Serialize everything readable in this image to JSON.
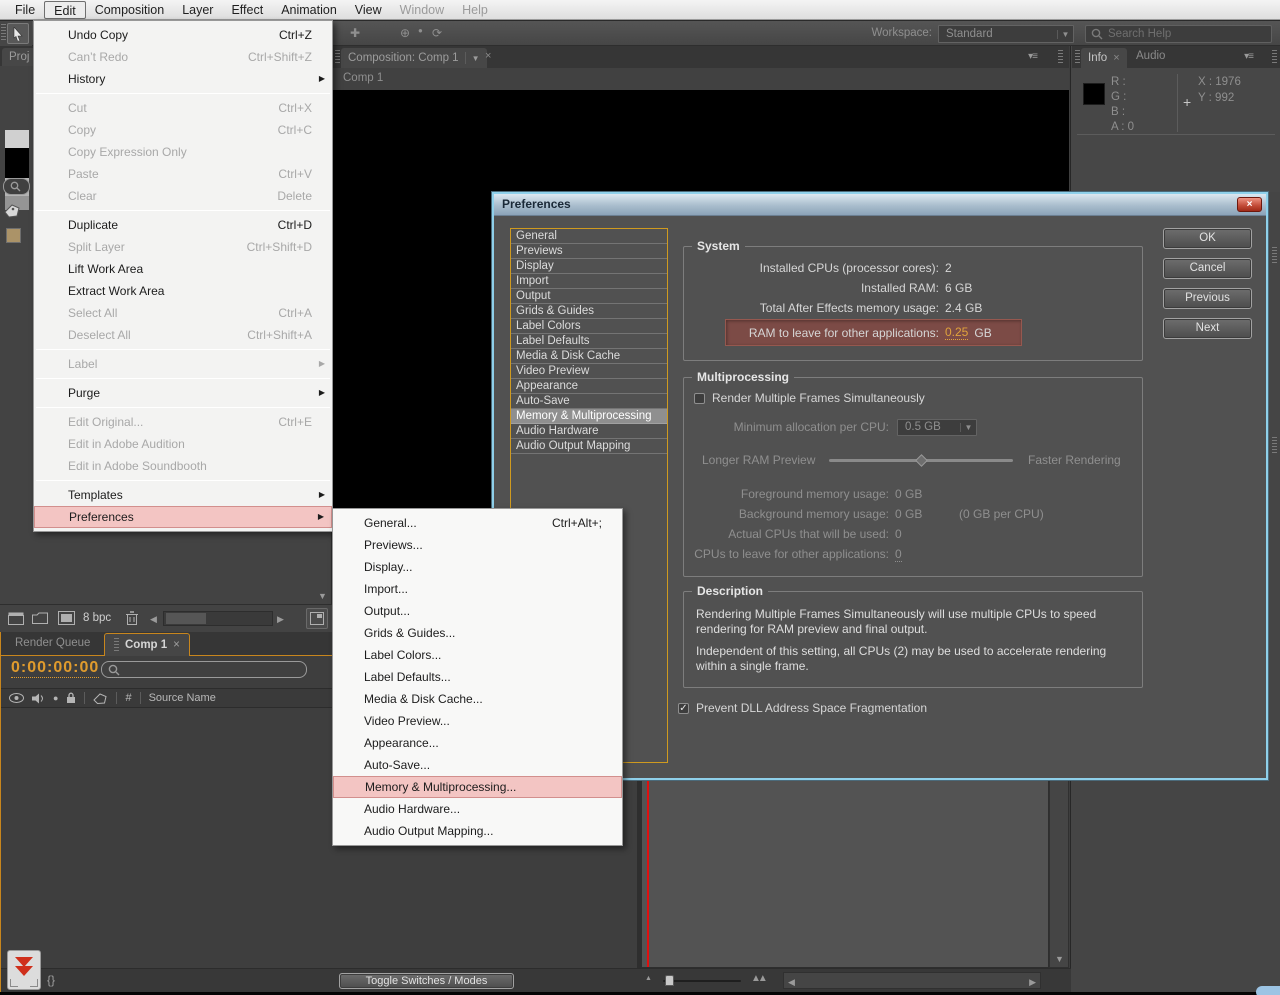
{
  "icons": {
    "close": "×",
    "submenu_arrow": "▶",
    "dropdown_arrow": "▼",
    "panel_menu": "▾≡",
    "scroll_left": "◀",
    "scroll_right": "▶",
    "scroll_down": "▼",
    "crosshair": "+",
    "check": "✓",
    "braces": "{}",
    "mountain_small": "▲",
    "mountain_big": "▲▲",
    "circle_dot": "●",
    "hash": "#",
    "move_tool": "✚",
    "anchor_tool": "⊕",
    "rotate_tool": "⟳"
  },
  "menu_bar": {
    "items": [
      {
        "label": "File"
      },
      {
        "label": "Edit",
        "active": true
      },
      {
        "label": "Composition"
      },
      {
        "label": "Layer"
      },
      {
        "label": "Effect"
      },
      {
        "label": "Animation"
      },
      {
        "label": "View"
      },
      {
        "label": "Window",
        "dim": true
      },
      {
        "label": "Help",
        "dim": true
      }
    ]
  },
  "toolbar": {
    "workspace_label": "Workspace:",
    "workspace_value": "Standard",
    "search_placeholder": "Search Help"
  },
  "edit_menu": {
    "items": [
      {
        "label": "Undo Copy",
        "shortcut": "Ctrl+Z"
      },
      {
        "label": "Can’t Redo",
        "shortcut": "Ctrl+Shift+Z",
        "disabled": true
      },
      {
        "label": "History",
        "submenu": true
      },
      {
        "label": "Cut",
        "shortcut": "Ctrl+X",
        "disabled": true
      },
      {
        "label": "Copy",
        "shortcut": "Ctrl+C",
        "disabled": true
      },
      {
        "label": "Copy Expression Only",
        "disabled": true
      },
      {
        "label": "Paste",
        "shortcut": "Ctrl+V",
        "disabled": true
      },
      {
        "label": "Clear",
        "shortcut": "Delete",
        "disabled": true
      },
      {
        "label": "Duplicate",
        "shortcut": "Ctrl+D"
      },
      {
        "label": "Split Layer",
        "shortcut": "Ctrl+Shift+D",
        "disabled": true
      },
      {
        "label": "Lift Work Area"
      },
      {
        "label": "Extract Work Area"
      },
      {
        "label": "Select All",
        "shortcut": "Ctrl+A",
        "disabled": true
      },
      {
        "label": "Deselect All",
        "shortcut": "Ctrl+Shift+A",
        "disabled": true
      },
      {
        "label": "Label",
        "submenu": true,
        "disabled": true
      },
      {
        "label": "Purge",
        "submenu": true
      },
      {
        "label": "Edit Original...",
        "shortcut": "Ctrl+E",
        "disabled": true
      },
      {
        "label": "Edit in Adobe Audition",
        "disabled": true
      },
      {
        "label": "Edit in Adobe Soundbooth",
        "disabled": true
      },
      {
        "label": "Templates",
        "submenu": true
      },
      {
        "label": "Preferences",
        "submenu": true,
        "highlighted": true
      }
    ]
  },
  "preferences_submenu": {
    "items": [
      {
        "label": "General...",
        "shortcut": "Ctrl+Alt+;"
      },
      {
        "label": "Previews..."
      },
      {
        "label": "Display..."
      },
      {
        "label": "Import..."
      },
      {
        "label": "Output..."
      },
      {
        "label": "Grids & Guides..."
      },
      {
        "label": "Label Colors..."
      },
      {
        "label": "Label Defaults..."
      },
      {
        "label": "Media & Disk Cache..."
      },
      {
        "label": "Video Preview..."
      },
      {
        "label": "Appearance..."
      },
      {
        "label": "Auto-Save..."
      },
      {
        "label": "Memory & Multiprocessing...",
        "highlighted": true
      },
      {
        "label": "Audio Hardware..."
      },
      {
        "label": "Audio Output Mapping..."
      }
    ]
  },
  "comp_panel": {
    "tab_label": "Composition: Comp 1",
    "comp_name": "Comp 1"
  },
  "info_panel": {
    "tab_info": "Info",
    "tab_audio": "Audio",
    "r": "R :",
    "g": "G :",
    "b": "B :",
    "a": "A : 0",
    "x": "X : 1976",
    "y": "Y : 992"
  },
  "project_panel": {
    "tab_label": "Proj",
    "bpc": "8 bpc"
  },
  "timeline": {
    "tab_render_queue": "Render Queue",
    "tab_comp": "Comp 1",
    "timecode": "0:00:00:00",
    "source_name_col": "Source Name",
    "toggle_button": "Toggle Switches / Modes"
  },
  "dialog": {
    "title": "Preferences",
    "categories": [
      "General",
      "Previews",
      "Display",
      "Import",
      "Output",
      "Grids & Guides",
      "Label Colors",
      "Label Defaults",
      "Media & Disk Cache",
      "Video Preview",
      "Appearance",
      "Auto-Save",
      "Memory & Multiprocessing",
      "Audio Hardware",
      "Audio Output Mapping"
    ],
    "selected_category": "Memory & Multiprocessing",
    "buttons": {
      "ok": "OK",
      "cancel": "Cancel",
      "previous": "Previous",
      "next": "Next"
    },
    "system": {
      "title": "System",
      "installed_cpus_label": "Installed CPUs (processor cores):",
      "installed_cpus_value": "2",
      "installed_ram_label": "Installed RAM:",
      "installed_ram_value": "6 GB",
      "total_usage_label": "Total After Effects memory usage:",
      "total_usage_value": "2.4 GB",
      "ram_leave_label": "RAM to leave for other applications:",
      "ram_leave_value": "0.25",
      "ram_leave_unit": "GB"
    },
    "multiprocessing": {
      "title": "Multiprocessing",
      "render_multiple": "Render Multiple Frames Simultaneously",
      "min_alloc_label": "Minimum allocation per CPU:",
      "min_alloc_value": "0.5 GB",
      "slider_left": "Longer RAM Preview",
      "slider_right": "Faster Rendering",
      "fg_label": "Foreground memory usage:",
      "fg_value": "0 GB",
      "bg_label": "Background memory usage:",
      "bg_value": "0 GB",
      "bg_extra": "(0 GB per CPU)",
      "actual_label": "Actual CPUs that will be used:",
      "actual_value": "0",
      "leave_label": "CPUs to leave for other applications:",
      "leave_value": "0"
    },
    "description": {
      "title": "Description",
      "p1": "Rendering Multiple Frames Simultaneously will use multiple CPUs to speed rendering for RAM preview and final output.",
      "p2": "Independent of this setting, all CPUs (2) may be used to accelerate rendering within a single frame."
    },
    "prevent_dll": "Prevent DLL Address Space Fragmentation"
  },
  "colors": {
    "accent_orange": "#cf9a1f",
    "timecode_orange": "#e09b2d",
    "annotation_pink": "#f3c5c3",
    "annotation_border": "#d28f8d",
    "ram_highlight_bg": "#7c4b46",
    "dialog_border_blue": "#8fd0ea",
    "value_orange": "#e0a33c",
    "playhead_red": "#e01010"
  }
}
